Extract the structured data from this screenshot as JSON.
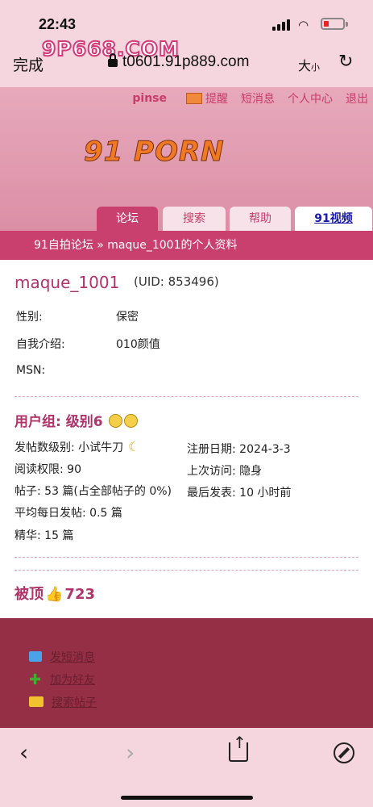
{
  "status_bar": {
    "time": "22:43"
  },
  "browser": {
    "watermark": "9P668.COM",
    "done_label": "完成",
    "url": "t0601.91p889.com",
    "text_size_label": "大",
    "text_size_small": "小"
  },
  "forum": {
    "topnav": {
      "username": "pinse",
      "remind": "提醒",
      "messages": "短消息",
      "profile_center": "个人中心",
      "logout": "退出"
    },
    "logo": "91 PORN",
    "tabs": [
      "论坛",
      "搜索",
      "帮助",
      "91视频"
    ],
    "breadcrumb": "91自拍论坛 » maque_1001的个人资料"
  },
  "profile": {
    "username": "maque_1001",
    "uid": "(UID: 853496)",
    "fields": [
      {
        "label": "性别:",
        "value": "保密"
      },
      {
        "label": "自我介绍:",
        "value": "010颜值"
      },
      {
        "label": "MSN:",
        "value": ""
      }
    ],
    "user_group": "用户组: 级别6",
    "stats_left": [
      "发帖数级别: 小试牛刀",
      "阅读权限: 90",
      "帖子: 53 篇(占全部帖子的 0%)",
      "平均每日发帖: 0.5 篇",
      "精华: 15 篇"
    ],
    "stats_right": [
      "注册日期: 2024-3-3",
      "上次访问: 隐身",
      "最后发表: 10 小时前"
    ],
    "upvote_label": "被顶",
    "upvote_count": "723"
  },
  "actions": [
    "发短消息",
    "加为好友",
    "搜索帖子"
  ]
}
